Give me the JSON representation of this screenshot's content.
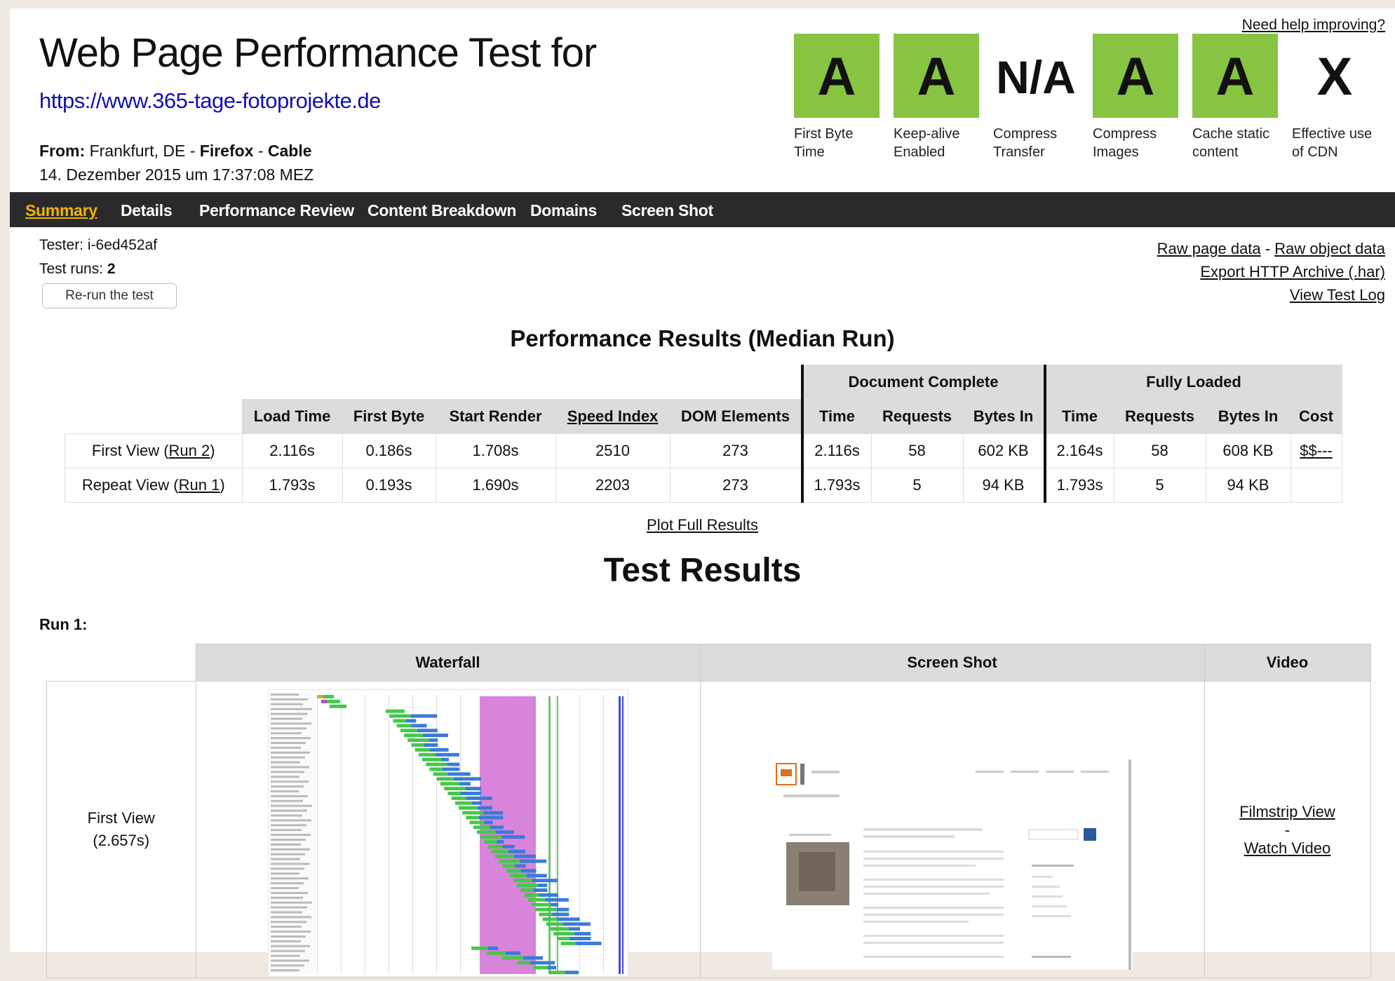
{
  "header": {
    "title": "Web Page Performance Test for",
    "url": "https://www.365-tage-fotoprojekte.de",
    "from_label": "From:",
    "from_location": "Frankfurt, DE -",
    "from_browser": "Firefox",
    "from_sep": "-",
    "from_connection": "Cable",
    "date": "14. Dezember 2015 um 17:37:08 MEZ",
    "help_link": "Need help improving?"
  },
  "grades": [
    {
      "value": "A",
      "label": "First Byte Time",
      "color": "#86c441"
    },
    {
      "value": "A",
      "label": "Keep-alive Enabled",
      "color": "#86c441"
    },
    {
      "value": "N/A",
      "label": "Compress Transfer",
      "color": "none"
    },
    {
      "value": "A",
      "label": "Compress Images",
      "color": "#86c441"
    },
    {
      "value": "A",
      "label": "Cache static content",
      "color": "#86c441"
    },
    {
      "value": "X",
      "label": "Effective use of CDN",
      "color": "none"
    }
  ],
  "nav": {
    "tabs": [
      "Summary",
      "Details",
      "Performance Review",
      "Content Breakdown",
      "Domains",
      "Screen Shot"
    ],
    "active": "Summary"
  },
  "test_info": {
    "tester": "Tester: i-6ed452af",
    "runs_label": "Test runs:",
    "runs_value": "2",
    "rerun_button": "Re-run the test"
  },
  "data_links": {
    "raw_page": "Raw page data",
    "sep": "-",
    "raw_object": "Raw object data",
    "export_har": "Export HTTP Archive (.har)",
    "view_log": "View Test Log"
  },
  "performance": {
    "title": "Performance Results (Median Run)",
    "group_doc": "Document Complete",
    "group_full": "Fully Loaded",
    "columns": [
      "Load Time",
      "First Byte",
      "Start Render",
      "Speed Index",
      "DOM Elements",
      "Time",
      "Requests",
      "Bytes In",
      "Time",
      "Requests",
      "Bytes In",
      "Cost"
    ],
    "rows": [
      {
        "label": "First View (",
        "run": "Run 2",
        "close": ")",
        "cells": [
          "2.116s",
          "0.186s",
          "1.708s",
          "2510",
          "273",
          "2.116s",
          "58",
          "602 KB",
          "2.164s",
          "58",
          "608 KB",
          "$$---"
        ]
      },
      {
        "label": "Repeat View (",
        "run": "Run 1",
        "close": ")",
        "cells": [
          "1.793s",
          "0.193s",
          "1.690s",
          "2203",
          "273",
          "1.793s",
          "5",
          "94 KB",
          "1.793s",
          "5",
          "94 KB",
          ""
        ]
      }
    ],
    "plot_link": "Plot Full Results"
  },
  "results": {
    "title": "Test Results",
    "run_label": "Run 1:",
    "col_waterfall": "Waterfall",
    "col_screenshot": "Screen Shot",
    "col_video": "Video",
    "first_view_label": "First View",
    "first_view_time": "(2.657s)",
    "filmstrip_link": "Filmstrip View",
    "video_sep": "-",
    "watch_video_link": "Watch Video"
  }
}
